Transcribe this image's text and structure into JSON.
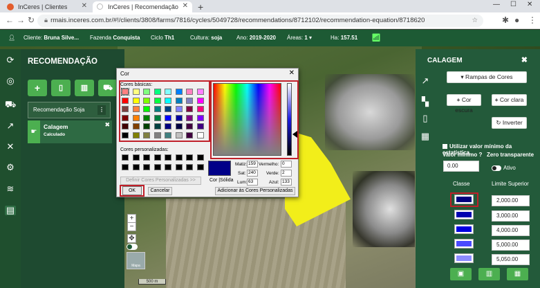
{
  "browser": {
    "tabs": [
      {
        "label": "InCeres | Clientes"
      },
      {
        "label": "InCeres | Recomendação"
      }
    ],
    "url": "rmais.inceres.com.br/#!/clients/3808/farms/7816/cycles/5049728/recommendations/8712102/recommendation-equation/8718620"
  },
  "header": {
    "cliente_label": "Cliente:",
    "cliente": "Bruna Silve...",
    "fazenda_label": "Fazenda",
    "fazenda": "Conquista",
    "ciclo_label": "Ciclo",
    "ciclo": "Th1",
    "cultura_label": "Cultura:",
    "cultura": "soja",
    "ano_label": "Ano:",
    "ano": "2019-2020",
    "areas_label": "Áreas:",
    "areas": "1",
    "ha_label": "Ha:",
    "ha": "157.51"
  },
  "left": {
    "title": "RECOMENDAÇÃO",
    "rec_name": "Recomendação Soja",
    "more_label": "⋮",
    "layer": {
      "name": "Calagem",
      "status": "Calculado"
    }
  },
  "map": {
    "scale_label": "500 m",
    "minimap_label": "Mapa"
  },
  "right": {
    "title": "CALAGEM",
    "ramps_label": "▾ Rampas de Cores",
    "dark_label": "Cor escura",
    "light_label": "Cor clara",
    "invert_label": "Inverter",
    "stat_min_label": "Utilizar valor mínimo da estatística",
    "min_value_label": "Valor mínimo",
    "zero_transparent_label": "Zero transparente",
    "min_value": "0.00",
    "active_label": "Ativo",
    "col_class": "Classe",
    "col_limit": "Limite Superior",
    "classes": [
      {
        "color": "#000080",
        "limit": "2,000.00"
      },
      {
        "color": "#0000b0",
        "limit": "3,000.00"
      },
      {
        "color": "#0000e0",
        "limit": "4,000.00"
      },
      {
        "color": "#4a4aff",
        "limit": "5,000.00"
      },
      {
        "color": "#8c8cff",
        "limit": "5,050.00"
      }
    ]
  },
  "dialog": {
    "title": "Cor",
    "basic_label": "Cores básicas:",
    "custom_label": "Cores personalizadas:",
    "define_custom_label": "Definir Cores Personalizadas >>",
    "ok_label": "OK",
    "cancel_label": "Cancelar",
    "color_solid_label": "Cor |Sólida",
    "matiz_label": "Matiz:",
    "matiz": "159",
    "sat_label": "Sat:",
    "sat": "240",
    "lum_label": "Lum:",
    "lum": "63",
    "red_label": "Vermelho:",
    "red": "0",
    "green_label": "Verde:",
    "green": "2",
    "blue_label": "Azul:",
    "blue": "133",
    "add_custom_label": "Adicionar às Cores Personalizadas",
    "selected_color": "#000088",
    "basic_colors": [
      "#ff8080",
      "#ffff80",
      "#80ff80",
      "#00ff80",
      "#80ffff",
      "#0080ff",
      "#ff80c0",
      "#ff80ff",
      "#ff0000",
      "#ffff00",
      "#80ff00",
      "#00ff40",
      "#00ffff",
      "#0080c0",
      "#8080c0",
      "#ff00ff",
      "#804040",
      "#ff8040",
      "#00ff00",
      "#008080",
      "#004080",
      "#8080ff",
      "#800040",
      "#ff0080",
      "#800000",
      "#ff8000",
      "#008000",
      "#008040",
      "#0000ff",
      "#0000a0",
      "#800080",
      "#8000ff",
      "#400000",
      "#804000",
      "#004000",
      "#004040",
      "#000080",
      "#000040",
      "#400040",
      "#400080",
      "#000000",
      "#808000",
      "#808040",
      "#808080",
      "#408080",
      "#c0c0c0",
      "#400040",
      "#ffffff"
    ]
  }
}
